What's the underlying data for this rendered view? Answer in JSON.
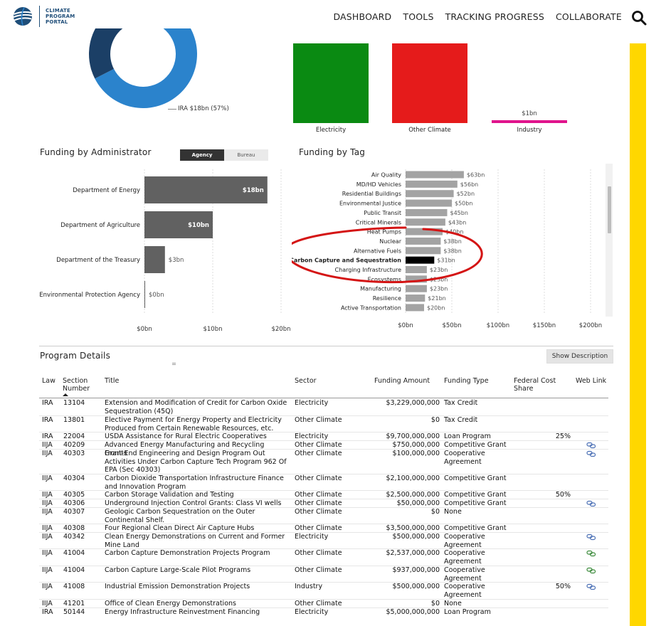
{
  "header": {
    "logo_lines": [
      "CLIMATE",
      "PROGRAM",
      "PORTAL"
    ],
    "nav": [
      "DASHBOARD",
      "TOOLS",
      "TRACKING PROGRESS",
      "COLLABORATE"
    ]
  },
  "colors": {
    "brand_blue": "#1f4e79",
    "donut_dark": "#1b3f66",
    "donut_light": "#2b83cc",
    "electricity": "#0a8a12",
    "other_climate": "#e51b1b",
    "industry": "#e0148c",
    "bar_gray": "#616161",
    "tag_gray": "#a3a3a3",
    "tag_selected": "#000000",
    "scroll_rail": "#FFD700",
    "annotation_red": "#d41414"
  },
  "donut": {
    "label": "IRA $18bn (57%)",
    "share_ira": 0.57
  },
  "sector_tiles": [
    {
      "label": "Electricity",
      "value_label": "",
      "fill": 1.0
    },
    {
      "label": "Other Climate",
      "value_label": "",
      "fill": 1.0
    },
    {
      "label": "Industry",
      "value_label": "$1bn",
      "fill": 0.03
    }
  ],
  "admin_chart": {
    "title": "Funding by Administrator",
    "toggle": {
      "options": [
        "Agency",
        "Bureau"
      ],
      "selected": "Agency"
    },
    "chart_data": {
      "type": "bar",
      "orientation": "horizontal",
      "categories": [
        "Department of Energy",
        "Department of Agriculture",
        "Department of the Treasury",
        "Environmental Protection Agency"
      ],
      "values": [
        18,
        10,
        3,
        0
      ],
      "value_labels": [
        "$18bn",
        "$10bn",
        "$3bn",
        "$0bn"
      ],
      "xlim": [
        0,
        20
      ],
      "xticks": [
        0,
        10,
        20
      ],
      "xtick_labels": [
        "$0bn",
        "$10bn",
        "$20bn"
      ],
      "grid": true
    }
  },
  "tag_chart": {
    "title": "Funding by Tag",
    "chart_data": {
      "type": "bar",
      "orientation": "horizontal",
      "categories": [
        "Air Quality",
        "MD/HD Vehicles",
        "Residential Buildings",
        "Environmental Justice",
        "Public Transit",
        "Critical Minerals",
        "Heat Pumps",
        "Nuclear",
        "Alternative Fuels",
        "Carbon Capture and Sequestration",
        "Charging Infrastructure",
        "Ecosystems",
        "Manufacturing",
        "Resilience",
        "Active Transportation"
      ],
      "values": [
        63,
        56,
        52,
        50,
        45,
        43,
        40,
        38,
        38,
        31,
        23,
        23,
        23,
        21,
        20
      ],
      "value_labels": [
        "$63bn",
        "$56bn",
        "$52bn",
        "$50bn",
        "$45bn",
        "$43bn",
        "$40bn",
        "$38bn",
        "$38bn",
        "$31bn",
        "$23bn",
        "$23bn",
        "$23bn",
        "$21bn",
        "$20bn"
      ],
      "selected": "Carbon Capture and Sequestration",
      "xlim": [
        0,
        200
      ],
      "xticks": [
        0,
        50,
        100,
        150,
        200
      ],
      "xtick_labels": [
        "$0bn",
        "$50bn",
        "$100bn",
        "$150bn",
        "$200bn"
      ],
      "grid": true
    }
  },
  "program_details": {
    "title": "Program Details",
    "show_description_label": "Show Description",
    "columns": {
      "law": "Law",
      "section": [
        "Section",
        "Number"
      ],
      "title": "Title",
      "sector": "Sector",
      "amount": "Funding Amount",
      "ftype": "Funding Type",
      "share": [
        "Federal Cost",
        "Share"
      ],
      "link": "Web Link"
    },
    "rows": [
      {
        "law": "IRA",
        "section": "13104",
        "title": "Extension and Modification of Credit for Carbon Oxide Sequestration (45Q)",
        "sector": "Electricity",
        "amount": "$3,229,000,000",
        "ftype": "Tax Credit",
        "share": "",
        "link": false
      },
      {
        "law": "IRA",
        "section": "13801",
        "title": "Elective Payment for Energy Property and Electricity Produced from Certain Renewable Resources, etc.",
        "sector": "Other Climate",
        "amount": "$0",
        "ftype": "Tax Credit",
        "share": "",
        "link": false
      },
      {
        "law": "IRA",
        "section": "22004",
        "title": "USDA Assistance for Rural Electric Cooperatives",
        "sector": "Electricity",
        "amount": "$9,700,000,000",
        "ftype": "Loan Program",
        "share": "25%",
        "link": false
      },
      {
        "law": "IIJA",
        "section": "40209",
        "title": "Advanced Energy Manufacturing and Recycling Grants",
        "sector": "Other Climate",
        "amount": "$750,000,000",
        "ftype": "Competitive Grant",
        "share": "",
        "link": true
      },
      {
        "law": "IIJA",
        "section": "40303",
        "title": "Front-End Engineering and Design Program Out Activities Under Carbon Capture Tech Program 962 Of EPA (Sec 40303)",
        "sector": "Other Climate",
        "amount": "$100,000,000",
        "ftype": "Cooperative Agreement",
        "share": "",
        "link": true
      },
      {
        "law": "IIJA",
        "section": "40304",
        "title": "Carbon Dioxide Transportation Infrastructure Finance and Innovation Program",
        "sector": "Other Climate",
        "amount": "$2,100,000,000",
        "ftype": "Competitive Grant",
        "share": "",
        "link": false
      },
      {
        "law": "IIJA",
        "section": "40305",
        "title": "Carbon Storage Validation and Testing",
        "sector": "Other Climate",
        "amount": "$2,500,000,000",
        "ftype": "Competitive Grant",
        "share": "50%",
        "link": false
      },
      {
        "law": "IIJA",
        "section": "40306",
        "title": "Underground Injection Control Grants: Class VI wells",
        "sector": "Other Climate",
        "amount": "$50,000,000",
        "ftype": "Competitive Grant",
        "share": "",
        "link": true
      },
      {
        "law": "IIJA",
        "section": "40307",
        "title": "Geologic Carbon Sequestration on the Outer Continental Shelf.",
        "sector": "Other Climate",
        "amount": "$0",
        "ftype": "None",
        "share": "",
        "link": false
      },
      {
        "law": "IIJA",
        "section": "40308",
        "title": "Four Regional Clean Direct Air Capture Hubs",
        "sector": "Other Climate",
        "amount": "$3,500,000,000",
        "ftype": "Competitive Grant",
        "share": "",
        "link": false
      },
      {
        "law": "IIJA",
        "section": "40342",
        "title": "Clean Energy Demonstrations on Current and Former Mine Land",
        "sector": "Electricity",
        "amount": "$500,000,000",
        "ftype": "Cooperative Agreement",
        "share": "",
        "link": true
      },
      {
        "law": "IIJA",
        "section": "41004",
        "title": "Carbon Capture Demonstration Projects Program",
        "sector": "Other Climate",
        "amount": "$2,537,000,000",
        "ftype": "Cooperative Agreement",
        "share": "",
        "link": true
      },
      {
        "law": "IIJA",
        "section": "41004",
        "title": "Carbon Capture Large-Scale Pilot Programs",
        "sector": "Other Climate",
        "amount": "$937,000,000",
        "ftype": "Cooperative Agreement",
        "share": "",
        "link": true
      },
      {
        "law": "IIJA",
        "section": "41008",
        "title": "Industrial Emission Demonstration Projects",
        "sector": "Industry",
        "amount": "$500,000,000",
        "ftype": "Cooperative Agreement",
        "share": "50%",
        "link": true
      },
      {
        "law": "IIJA",
        "section": "41201",
        "title": "Office of Clean Energy Demonstrations",
        "sector": "Other Climate",
        "amount": "$0",
        "ftype": "None",
        "share": "",
        "link": false
      },
      {
        "law": "IRA",
        "section": "50144",
        "title": "Energy Infrastructure Reinvestment Financing",
        "sector": "Electricity",
        "amount": "$5,000,000,000",
        "ftype": "Loan Program",
        "share": "",
        "link": false
      }
    ]
  }
}
